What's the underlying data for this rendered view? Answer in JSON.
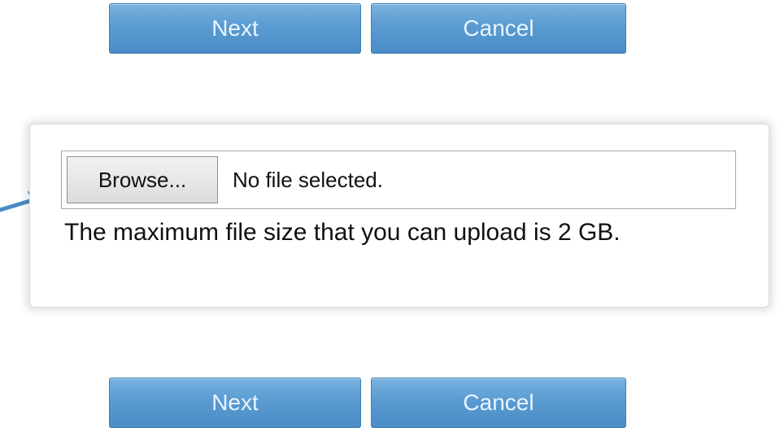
{
  "buttons": {
    "next_label": "Next",
    "cancel_label": "Cancel"
  },
  "file_upload": {
    "browse_label": "Browse...",
    "status_text": "No file selected.",
    "max_size_text": "The maximum file size that you can upload is 2 GB."
  },
  "colors": {
    "button_fill": "#5a9bd1",
    "button_text": "#e9f4ff",
    "arrow": "#4a8cc6"
  },
  "icons": {
    "pointer": "arrow-right-icon"
  }
}
